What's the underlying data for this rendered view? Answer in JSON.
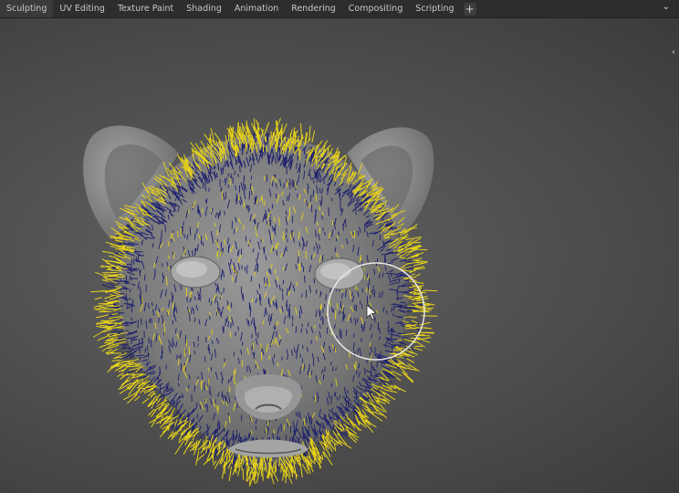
{
  "workspace_tabs": [
    {
      "label": "Sculpting"
    },
    {
      "label": "UV Editing"
    },
    {
      "label": "Texture Paint"
    },
    {
      "label": "Shading"
    },
    {
      "label": "Animation"
    },
    {
      "label": "Rendering"
    },
    {
      "label": "Compositing"
    },
    {
      "label": "Scripting"
    }
  ],
  "add_tab_label": "+",
  "topbar_icon": "chevron-down-icon",
  "sidebar_toggle_icon": "chevron-left-icon",
  "colors": {
    "hair_yellow": "#e6d21a",
    "hair_blue": "#1c1f6e",
    "mesh": "#8e8e8e",
    "brush_circle": "#e9e9e9"
  }
}
